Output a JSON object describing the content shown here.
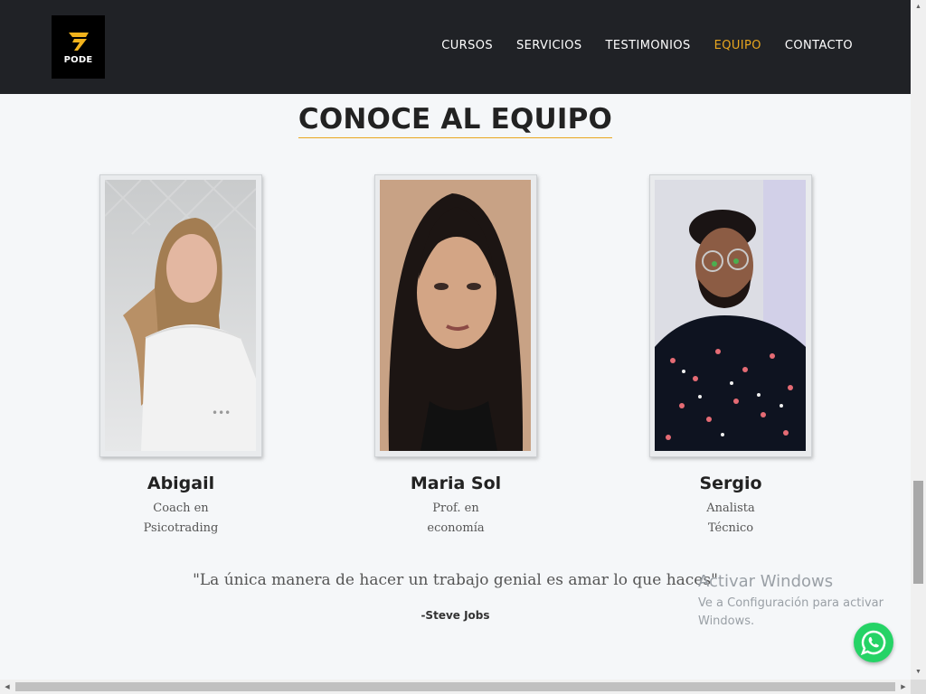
{
  "brand": {
    "name": "PODE",
    "accent_color": "#e8a61f"
  },
  "nav": {
    "items": [
      {
        "label": "CURSOS",
        "active": false
      },
      {
        "label": "SERVICIOS",
        "active": false
      },
      {
        "label": "TESTIMONIOS",
        "active": false
      },
      {
        "label": "EQUIPO",
        "active": true
      },
      {
        "label": "CONTACTO",
        "active": false
      }
    ]
  },
  "section": {
    "title": "CONOCE AL EQUIPO"
  },
  "team": [
    {
      "name": "Abigail",
      "role_line1": "Coach en",
      "role_line2": "Psicotrading"
    },
    {
      "name": "Maria Sol",
      "role_line1": "Prof. en",
      "role_line2": "economía"
    },
    {
      "name": "Sergio",
      "role_line1": "Analista",
      "role_line2": "Técnico"
    }
  ],
  "quote": {
    "text": "\"La única manera de hacer un trabajo genial es amar lo que haces\"",
    "author": "-Steve Jobs"
  },
  "windows_watermark": {
    "title": "Activar Windows",
    "line1": "Ve a Configuración para activar",
    "line2": "Windows."
  },
  "icons": {
    "whatsapp": "whatsapp-icon",
    "logo": "pode-logo-icon"
  }
}
